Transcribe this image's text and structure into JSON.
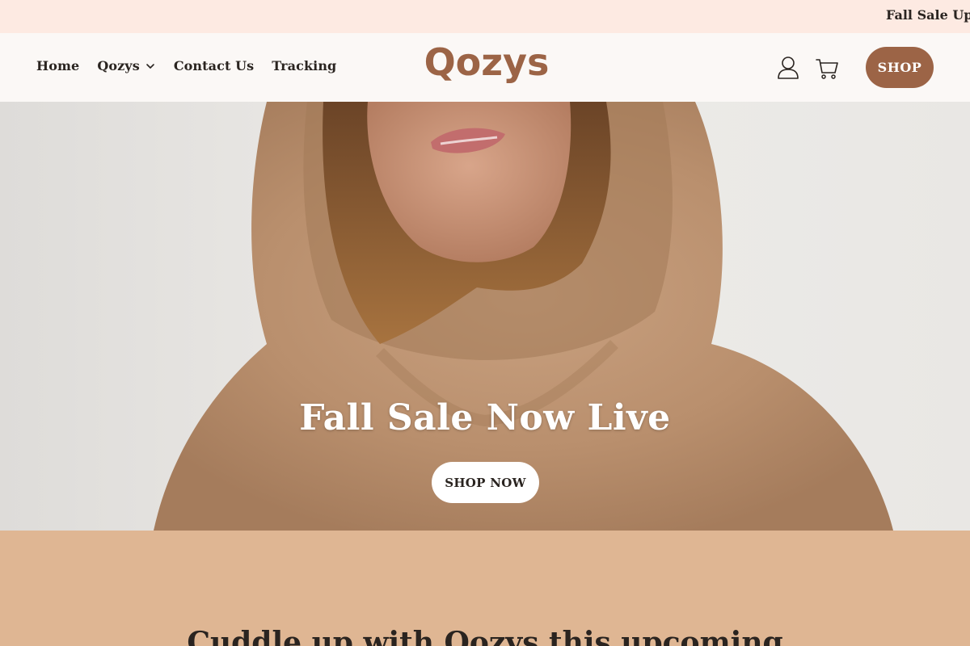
{
  "announcement": {
    "text": "Fall Sale Up T"
  },
  "header": {
    "nav": [
      {
        "label": "Home"
      },
      {
        "label": "Qozys",
        "has_dropdown": true
      },
      {
        "label": "Contact Us"
      },
      {
        "label": "Tracking"
      }
    ],
    "logo_text": "Qozys",
    "icons": {
      "account": "user-icon",
      "cart": "cart-icon"
    },
    "shop_label": "SHOP"
  },
  "hero": {
    "title": "Fall Sale Now Live",
    "button_label": "SHOP NOW"
  },
  "section": {
    "heading": "Cuddle up with Qozys this upcoming"
  },
  "colors": {
    "announcement_bg": "#fdeae2",
    "header_bg": "#fbf8f6",
    "brand": "#9c6446",
    "section_bg": "#dfb693",
    "text": "#2a2420"
  }
}
